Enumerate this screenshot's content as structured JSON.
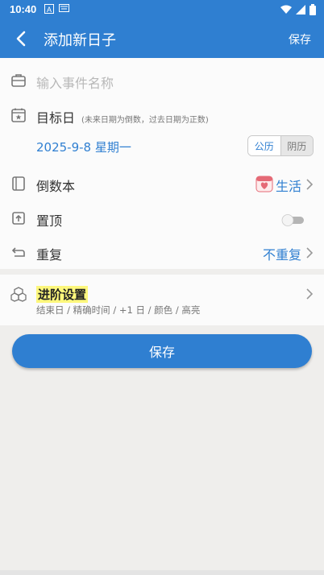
{
  "status": {
    "time": "10:40"
  },
  "appbar": {
    "title": "添加新日子",
    "save_label": "保存"
  },
  "event_name": {
    "placeholder": "输入事件名称"
  },
  "target_day": {
    "label": "目标日",
    "hint": "(未来日期为倒数，过去日期为正数)",
    "date": "2025-9-8 星期一",
    "calendar_options": [
      "公历",
      "阴历"
    ],
    "selected_calendar": "公历"
  },
  "book": {
    "label": "倒数本",
    "value": "生活"
  },
  "pin": {
    "label": "置顶",
    "enabled": false
  },
  "repeat": {
    "label": "重复",
    "value": "不重复"
  },
  "advanced": {
    "title": "进阶设置",
    "subtitle": "结束日 / 精确时间 / +1 日 / 颜色 / 高亮"
  },
  "primary_button": {
    "label": "保存"
  },
  "colors": {
    "accent": "#2f7fd1",
    "highlight": "#fdf77c"
  }
}
